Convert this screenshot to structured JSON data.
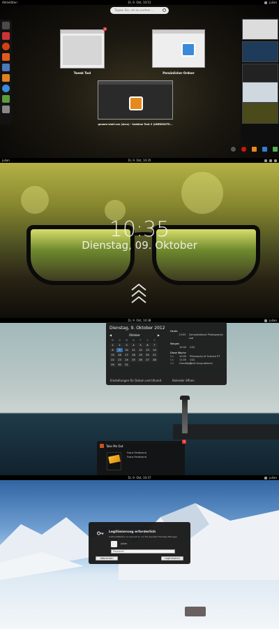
{
  "panel1": {
    "topbar": {
      "left": "Aktivitäten",
      "center": "Di, 9. Okt, 10:51",
      "user": "julian"
    },
    "search_placeholder": "Tippen Sie, um zu suchen ...",
    "windows": [
      {
        "label": "Tweak Tool"
      },
      {
        "label": "Persönlicher Ordner"
      },
      {
        "label": "gnome-shell.css (shcs) - Sublime Text 2 (UNREGISTE..."
      }
    ],
    "bottom_user": "julian"
  },
  "panel2": {
    "topbar": {
      "center": "Di, 9. Okt, 10:35",
      "user": "julian"
    },
    "clock": "10:35",
    "date": "Dienstag, 09. Oktober"
  },
  "panel3": {
    "topbar": {
      "center": "Di, 9. Okt, 10:38",
      "user": "julian"
    },
    "calendar": {
      "title": "Dienstag, 9. Oktober 2012",
      "month": "Oktober",
      "weekdays": [
        "M",
        "D",
        "M",
        "D",
        "F",
        "S",
        "S"
      ],
      "days": [
        "1",
        "2",
        "3",
        "4",
        "5",
        "6",
        "7",
        "8",
        "9",
        "10",
        "11",
        "12",
        "13",
        "14",
        "15",
        "16",
        "17",
        "18",
        "19",
        "20",
        "21",
        "22",
        "23",
        "24",
        "25",
        "26",
        "27",
        "28",
        "29",
        "30",
        "31"
      ],
      "settings_label": "Einstellungen für Datum und Uhrzeit",
      "open_calendar_label": "Kalender öffnen",
      "events": {
        "heute_label": "Heute",
        "heute": [
          {
            "time": "13:00",
            "title": "Computational Photography Lab"
          }
        ],
        "morgen_label": "Morgen",
        "morgen": [
          {
            "time": "10:00",
            "title": "CG2"
          }
        ],
        "week_label": "Diese Woche",
        "week": [
          {
            "day": "Do",
            "time": "10:00",
            "title": "Philosophy of Science ET"
          },
          {
            "day": "Do",
            "time": "11:00",
            "title": "CG2"
          },
          {
            "day": "Do",
            "time": "Ganztägig",
            "title": "Gruß Ausprobieren"
          }
        ]
      }
    },
    "notification": {
      "app": "Take Me Out",
      "line1": "Franz Ferdinand",
      "line2": "Franz Ferdinand"
    }
  },
  "panel4": {
    "topbar": {
      "center": "Di, 9. Okt, 10:37",
      "user": "julian"
    },
    "dialog": {
      "title": "Legitimierung erforderlich",
      "subtitle": "Authentifikation is required to run the Synaptic Package Manager",
      "user": "julian",
      "password_placeholder": "Passwort:",
      "cancel": "Abbrechen",
      "login": "Legitimieren"
    }
  },
  "colors": {
    "accent": "#3a6ea5",
    "close_red": "#dd3333",
    "dark_panel": "#191919"
  }
}
